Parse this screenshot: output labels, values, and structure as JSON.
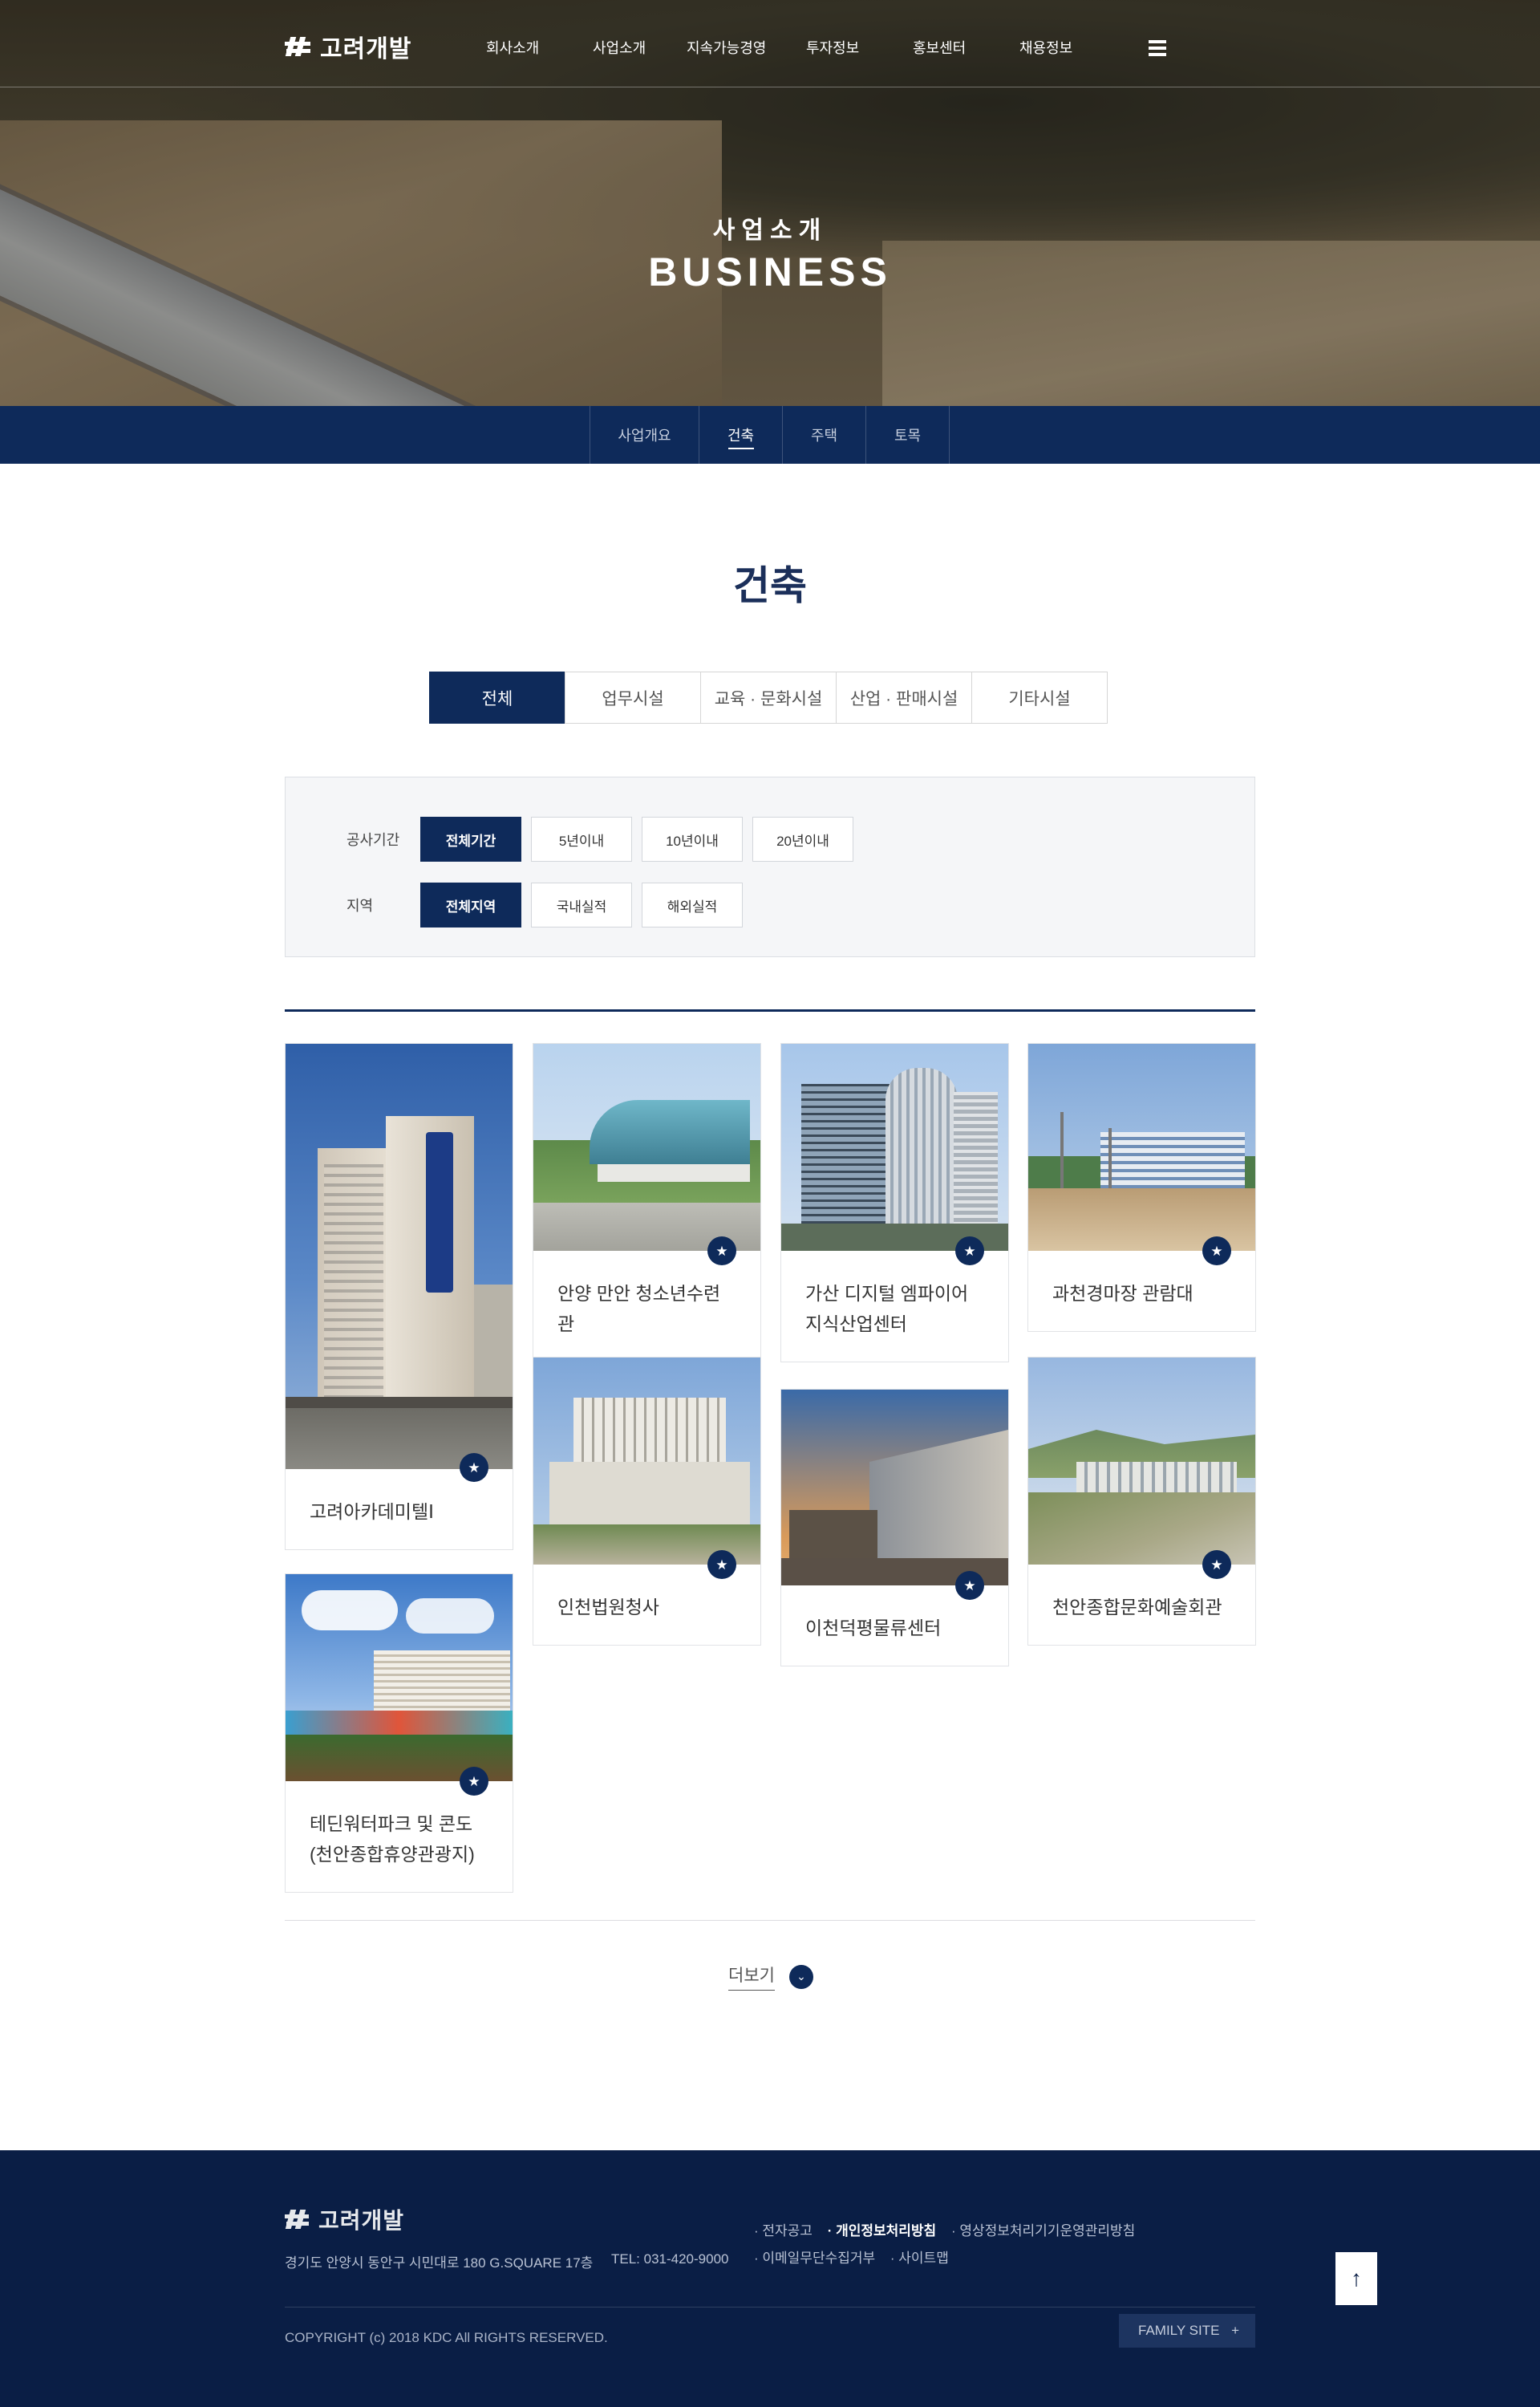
{
  "brand": {
    "logo_text": "고려개발"
  },
  "gnb": [
    {
      "label": "회사소개"
    },
    {
      "label": "사업소개"
    },
    {
      "label": "지속가능경영"
    },
    {
      "label": "투자정보"
    },
    {
      "label": "홍보센터"
    },
    {
      "label": "채용정보"
    }
  ],
  "hero": {
    "subtitle": "사업소개",
    "title": "BUSINESS"
  },
  "subnav": [
    {
      "label": "사업개요",
      "active": false
    },
    {
      "label": "건축",
      "active": true
    },
    {
      "label": "주택",
      "active": false
    },
    {
      "label": "토목",
      "active": false
    }
  ],
  "page": {
    "title": "건축"
  },
  "category_tabs": [
    {
      "label": "전체",
      "active": true
    },
    {
      "label": "업무시설",
      "active": false
    },
    {
      "label": "교육 · 문화시설",
      "active": false
    },
    {
      "label": "산업 · 판매시설",
      "active": false
    },
    {
      "label": "기타시설",
      "active": false
    }
  ],
  "filters": {
    "period": {
      "label": "공사기간",
      "options": [
        "전체기간",
        "5년이내",
        "10년이내",
        "20년이내"
      ],
      "selected": "전체기간"
    },
    "region": {
      "label": "지역",
      "options": [
        "전체지역",
        "국내실적",
        "해외실적"
      ],
      "selected": "전체지역"
    }
  },
  "projects": [
    {
      "title": "고려아카데미텔Ⅰ"
    },
    {
      "title": "안양 만안 청소년수련관"
    },
    {
      "title": "가산 디지털 엠파이어 지식산업센터"
    },
    {
      "title": "과천경마장 관람대"
    },
    {
      "title": "인천법원청사"
    },
    {
      "title": "이천덕평물류센터"
    },
    {
      "title": "천안종합문화예술회관"
    },
    {
      "title": "테딘워터파크 및 콘도(천안종합휴양관광지)"
    }
  ],
  "more": {
    "label": "더보기"
  },
  "footer": {
    "logo_text": "고려개발",
    "address": "경기도 안양시 동안구 시민대로 180 G.SQUARE 17층",
    "tel": "TEL: 031-420-9000",
    "links": [
      {
        "label": "전자공고",
        "bold": false
      },
      {
        "label": "개인정보처리방침",
        "bold": true
      },
      {
        "label": "영상정보처리기기운영관리방침",
        "bold": false
      },
      {
        "label": "이메일무단수집거부",
        "bold": false
      },
      {
        "label": "사이트맵",
        "bold": false
      }
    ],
    "copyright": "COPYRIGHT (c) 2018 KDC All RIGHTS RESERVED.",
    "family_site": "FAMILY SITE"
  },
  "colors": {
    "primary": "#0e2a5a",
    "footer_bg": "#0a1e45"
  }
}
